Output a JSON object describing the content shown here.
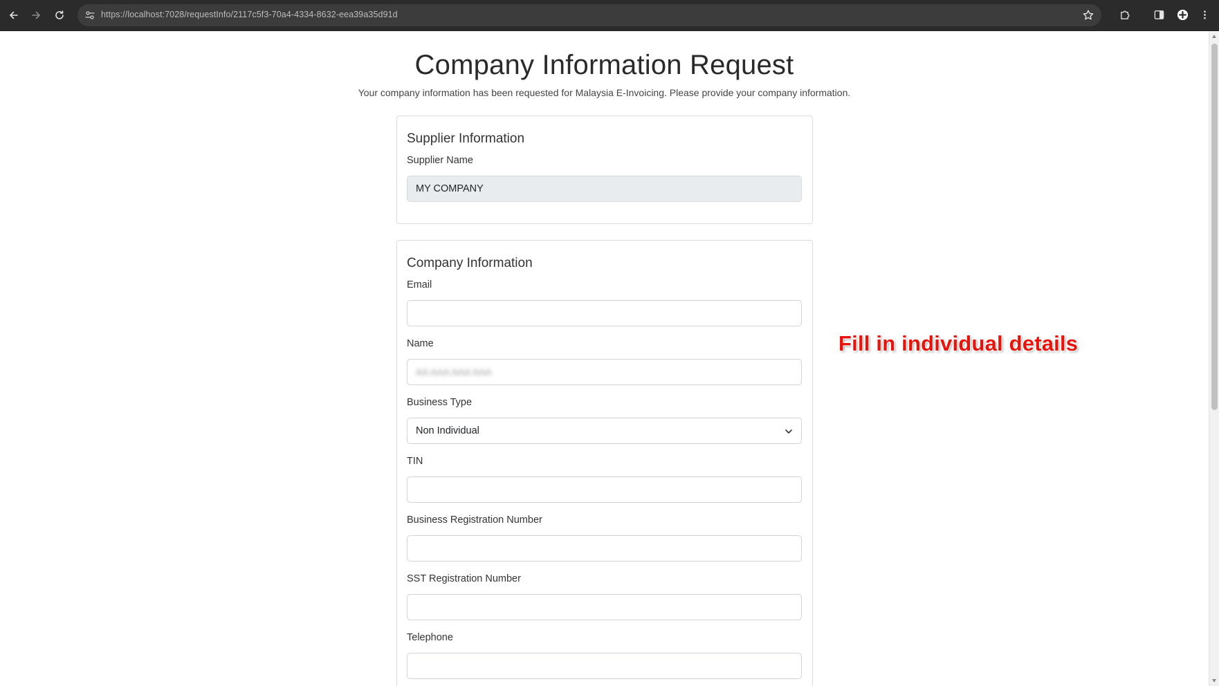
{
  "browser": {
    "url": "https://localhost:7028/requestInfo/2117c5f3-70a4-4334-8632-eea39a35d91d"
  },
  "page": {
    "title": "Company Information Request",
    "subtitle": "Your company information has been requested for Malaysia E-Invoicing. Please provide your company information."
  },
  "supplier": {
    "section_title": "Supplier Information",
    "name_label": "Supplier Name",
    "name_value": "MY COMPANY"
  },
  "company": {
    "section_title": "Company Information",
    "email_label": "Email",
    "email_value": "",
    "name_label": "Name",
    "name_value": "AA AAA AAA AAA",
    "business_type_label": "Business Type",
    "business_type_value": "Non Individual",
    "tin_label": "TIN",
    "tin_value": "",
    "brn_label": "Business Registration Number",
    "brn_value": "",
    "sst_label": "SST Registration Number",
    "sst_value": "",
    "telephone_label": "Telephone",
    "telephone_value": ""
  },
  "annotation": {
    "text": "Fill in individual details",
    "color": "#e8140c"
  },
  "icons": {
    "back": "arrow-left-icon",
    "forward": "arrow-right-icon",
    "reload": "reload-icon",
    "site_info": "site-settings-icon",
    "bookmark": "star-icon",
    "extensions": "puzzle-icon",
    "side_panel": "side-panel-icon",
    "profile": "profile-icon",
    "menu": "kebab-menu-icon"
  }
}
